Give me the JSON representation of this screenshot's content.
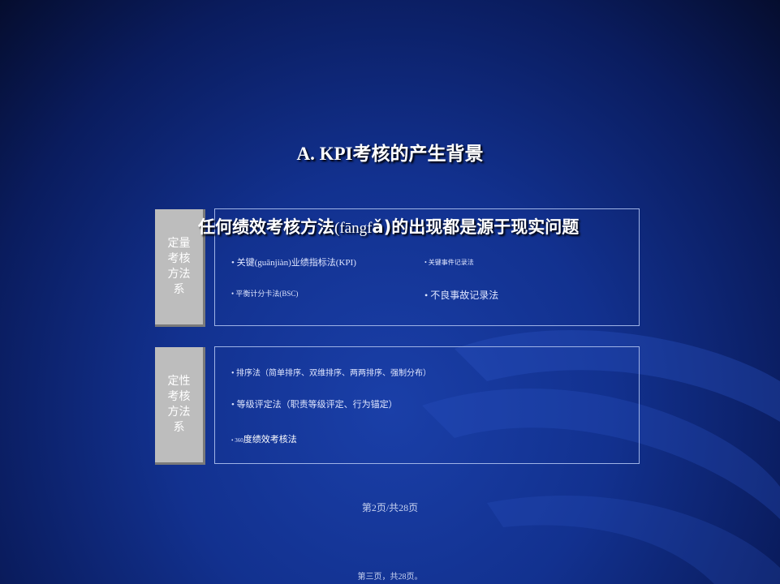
{
  "slide": {
    "title": "A. KPI考核的产生背景",
    "overlay_heading_part1": "任何绩效考核方法",
    "overlay_heading_mid": "(fāngf",
    "overlay_heading_part2": "ǎ)的出现都是源于现实问题",
    "quantitative": {
      "label": "定量考核方法系",
      "items": [
        "• 关键(guānjiàn)业绩指标法(KPI)",
        "• 关键事件记录法",
        "• 平衡计分卡法(BSC)",
        "• 不良事故记录法"
      ]
    },
    "qualitative": {
      "label": "定性考核方法系",
      "items": [
        "• 排序法（简单排序、双维排序、两两排序、强制分布）",
        "• 等级评定法（职责等级评定、行为锚定）",
        "• 360",
        "度绩效考核法"
      ]
    },
    "page_indicator": "第2页/共28页",
    "footer": "第三页，共28页。"
  }
}
